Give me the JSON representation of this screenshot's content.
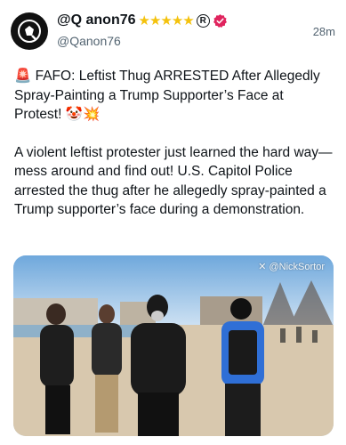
{
  "post": {
    "author": {
      "display_name": "@Q anon76",
      "stars": "★★★★★",
      "registered_mark": "R",
      "handle": "@Qanon76",
      "avatar_icon": "q-emblem-icon",
      "verified_color": "#e0245e"
    },
    "timestamp": "28m",
    "headline": "🚨 FAFO: Leftist Thug ARRESTED After Allegedly Spray-Painting a Trump Supporter’s Face at Protest! 🤡💥",
    "body": "A violent leftist protester just learned the hard way—mess around and find out! U.S. Capitol Police arrested the thug after he allegedly spray-painted a Trump supporter’s face during a demonstration.",
    "media": {
      "watermark": "✕ @NickSortor"
    }
  },
  "colors": {
    "star": "#f4c20d",
    "secondary_text": "#536471",
    "primary_text": "#0f1419"
  }
}
